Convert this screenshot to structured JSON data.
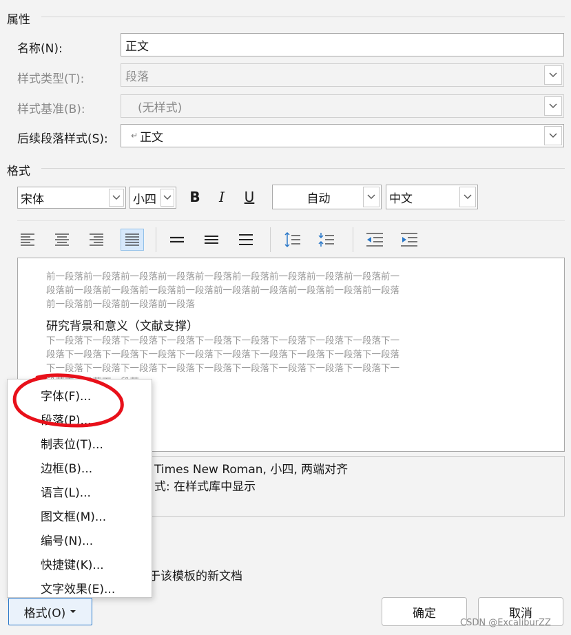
{
  "sections": {
    "properties": "属性",
    "format": "格式"
  },
  "props": {
    "name_label": "名称(N):",
    "name_value": "正文",
    "type_label": "样式类型(T):",
    "type_value": "段落",
    "base_label": "样式基准(B):",
    "base_value": "(无样式)",
    "next_label": "后续段落样式(S):",
    "next_value": "正文",
    "next_glyph": "↵"
  },
  "toolbar": {
    "font": "宋体",
    "size": "小四",
    "bold": "B",
    "italic": "I",
    "underline": "U",
    "color": "自动",
    "script": "中文"
  },
  "preview": {
    "prev_lines": [
      "前一段落前一段落前一段落前一段落前一段落前一段落前一段落前一段落前一段落前一",
      "段落前一段落前一段落前一段落前一段落前一段落前一段落前一段落前一段落前一段落",
      "前一段落前一段落前一段落前一段落"
    ],
    "sample": "研究背景和意义（文献支撑）",
    "next_lines": [
      "下一段落下一段落下一段落下一段落下一段落下一段落下一段落下一段落下一段落下一",
      "段落下一段落下一段落下一段落下一段落下一段落下一段落下一段落下一段落下一段落",
      "下一段落下一段落下一段落下一段落下一段落下一段落下一段落下一段落下一段落下一",
      "段落下一段落下一段落"
    ]
  },
  "description": {
    "line1": "Times New Roman, 小四, 两端对齐",
    "line2": "式: 在样式库中显示"
  },
  "template_option": "于该模板的新文档",
  "menu": {
    "items": [
      "字体(F)...",
      "段落(P)...",
      "制表位(T)...",
      "边框(B)...",
      "语言(L)...",
      "图文框(M)...",
      "编号(N)...",
      "快捷键(K)...",
      "文字效果(E)..."
    ]
  },
  "buttons": {
    "format": "格式(O)",
    "ok": "确定",
    "cancel": "取消"
  },
  "watermark": "CSDN @ExcaliburZZ",
  "colors": {
    "annotation": "#e8101a",
    "accent": "#2b78c8"
  }
}
